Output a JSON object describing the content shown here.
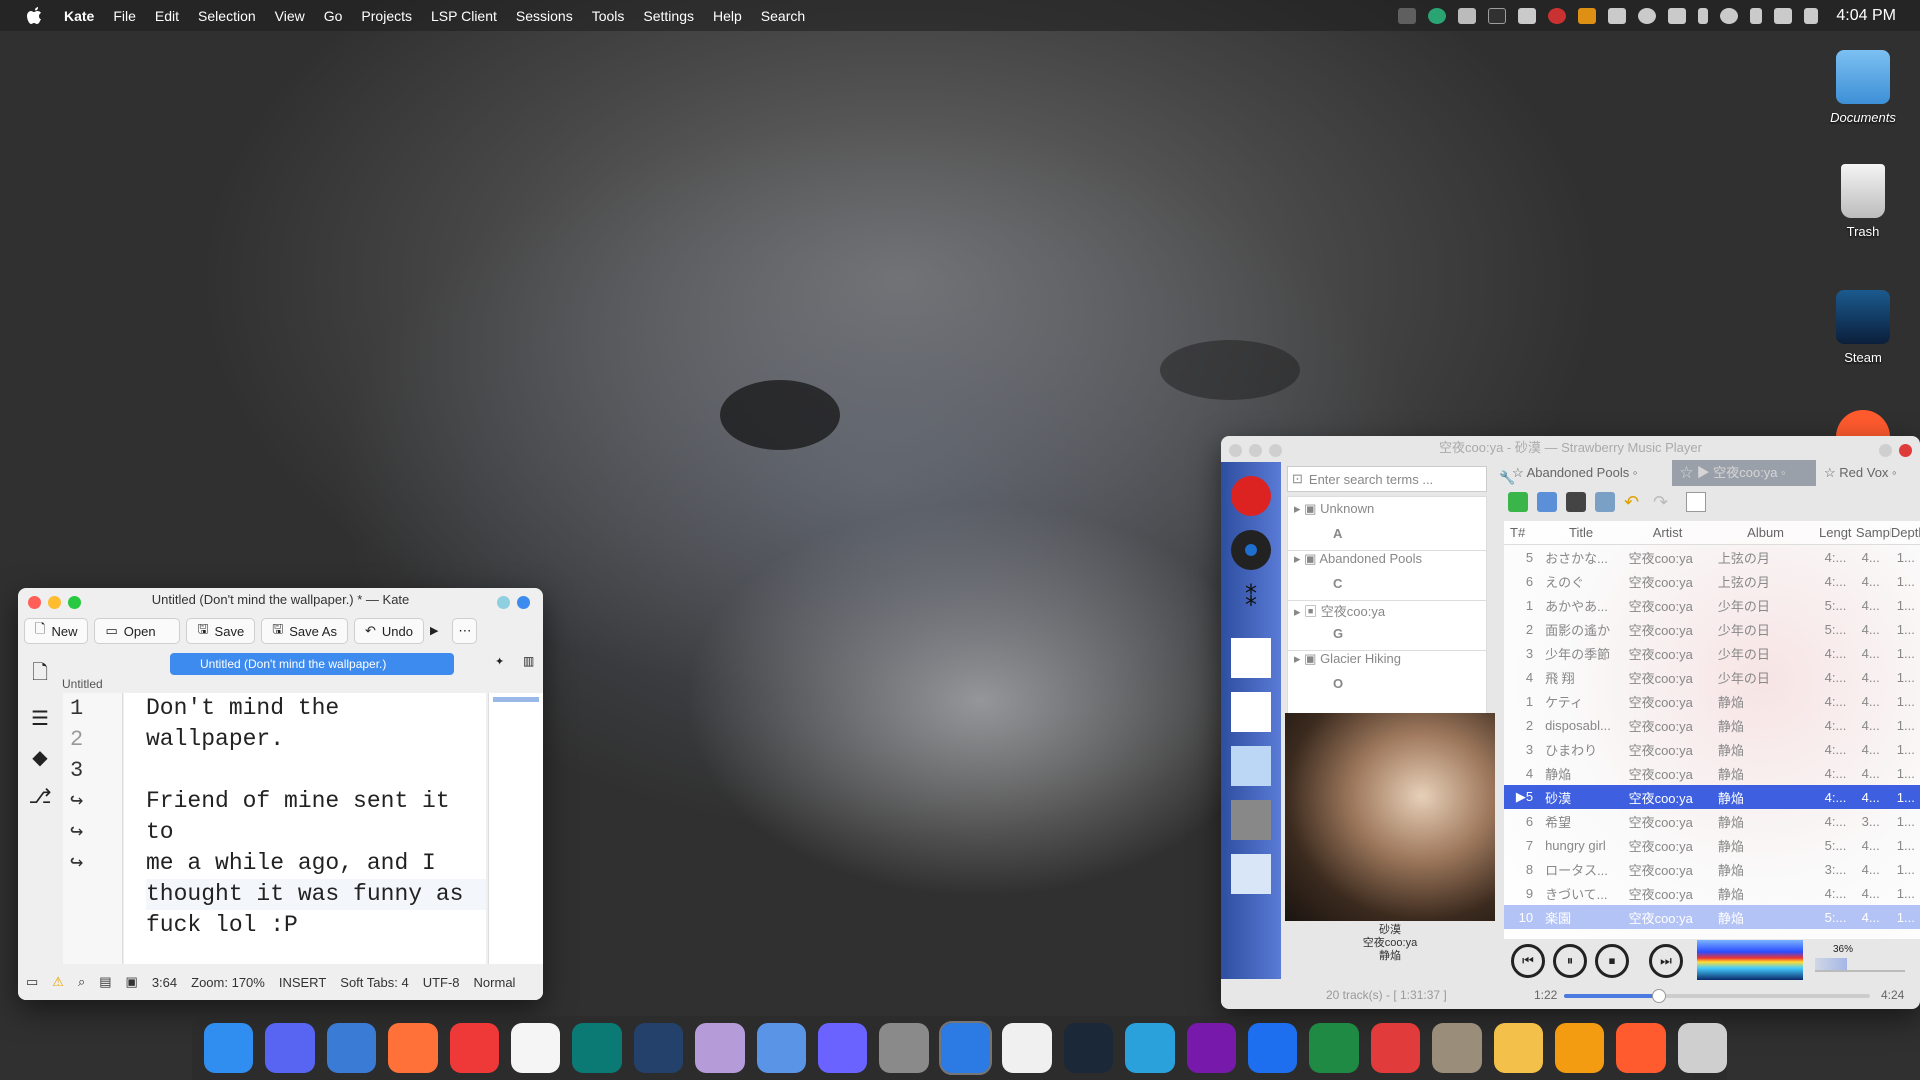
{
  "menubar": {
    "app": "Kate",
    "items": [
      "File",
      "Edit",
      "Selection",
      "View",
      "Go",
      "Projects",
      "LSP Client",
      "Sessions",
      "Tools",
      "Settings",
      "Help",
      "Search"
    ],
    "time": "4:04 PM"
  },
  "desktop": [
    {
      "label": "Documents"
    },
    {
      "label": "Trash"
    },
    {
      "label": "Steam"
    }
  ],
  "kate": {
    "title": "Untitled (Don't mind the wallpaper.) * — Kate",
    "toolbar": {
      "new": "New",
      "open": "Open",
      "save": "Save",
      "save_as": "Save As",
      "undo": "Undo"
    },
    "tab": "Untitled (Don't mind the wallpaper.)",
    "doc_label": "Untitled",
    "line_numbers": [
      "1",
      "2",
      "3",
      "↪",
      "↪",
      "↪"
    ],
    "lines": [
      "Don't mind the wallpaper.",
      "",
      "Friend of mine sent it to",
      "me a while ago, and I",
      "thought it was funny as",
      "fuck lol :P"
    ],
    "status": {
      "position": "3:64",
      "zoom": "Zoom: 170%",
      "mode": "INSERT",
      "tabs": "Soft Tabs: 4",
      "encoding": "UTF-8",
      "filetype": "Normal"
    }
  },
  "strawberry": {
    "title": "空夜coo:ya - 砂漠 — Strawberry Music Player",
    "search_placeholder": "Enter search terms ...",
    "collection": [
      {
        "name": "Unknown",
        "letter": "A"
      },
      {
        "name": "Abandoned Pools",
        "letter": "C"
      },
      {
        "name": "空夜coo:ya",
        "letter": "G"
      },
      {
        "name": "Glacier Hiking",
        "letter": "O"
      }
    ],
    "playlist_tabs": [
      "Abandoned Pools",
      "空夜coo:ya",
      "Red Vox"
    ],
    "columns": [
      "T#",
      "Title",
      "Artist",
      "Album",
      "Lengt",
      "Sample R",
      "Depth"
    ],
    "rows": [
      {
        "n": "5",
        "title": "おさかな...",
        "artist": "空夜coo:ya",
        "album": "上弦の月",
        "len": "4:...",
        "sr": "4...",
        "d": "1..."
      },
      {
        "n": "6",
        "title": "えのぐ",
        "artist": "空夜coo:ya",
        "album": "上弦の月",
        "len": "4:...",
        "sr": "4...",
        "d": "1..."
      },
      {
        "n": "1",
        "title": "あかやあ...",
        "artist": "空夜coo:ya",
        "album": "少年の日",
        "len": "5:...",
        "sr": "4...",
        "d": "1..."
      },
      {
        "n": "2",
        "title": "面影の遙か",
        "artist": "空夜coo:ya",
        "album": "少年の日",
        "len": "5:...",
        "sr": "4...",
        "d": "1..."
      },
      {
        "n": "3",
        "title": "少年の季節",
        "artist": "空夜coo:ya",
        "album": "少年の日",
        "len": "4:...",
        "sr": "4...",
        "d": "1..."
      },
      {
        "n": "4",
        "title": "飛 翔",
        "artist": "空夜coo:ya",
        "album": "少年の日",
        "len": "4:...",
        "sr": "4...",
        "d": "1..."
      },
      {
        "n": "1",
        "title": "ケティ",
        "artist": "空夜coo:ya",
        "album": "静焔",
        "len": "4:...",
        "sr": "4...",
        "d": "1..."
      },
      {
        "n": "2",
        "title": "disposabl...",
        "artist": "空夜coo:ya",
        "album": "静焔",
        "len": "4:...",
        "sr": "4...",
        "d": "1..."
      },
      {
        "n": "3",
        "title": "ひまわり",
        "artist": "空夜coo:ya",
        "album": "静焔",
        "len": "4:...",
        "sr": "4...",
        "d": "1..."
      },
      {
        "n": "4",
        "title": "静焔",
        "artist": "空夜coo:ya",
        "album": "静焔",
        "len": "4:...",
        "sr": "4...",
        "d": "1..."
      },
      {
        "n": "▶5",
        "title": "砂漠",
        "artist": "空夜coo:ya",
        "album": "静焔",
        "len": "4:...",
        "sr": "4...",
        "d": "1..."
      },
      {
        "n": "6",
        "title": "希望",
        "artist": "空夜coo:ya",
        "album": "静焔",
        "len": "4:...",
        "sr": "3...",
        "d": "1..."
      },
      {
        "n": "7",
        "title": "hungry girl",
        "artist": "空夜coo:ya",
        "album": "静焔",
        "len": "5:...",
        "sr": "4...",
        "d": "1..."
      },
      {
        "n": "8",
        "title": "ロータス...",
        "artist": "空夜coo:ya",
        "album": "静焔",
        "len": "3:...",
        "sr": "4...",
        "d": "1..."
      },
      {
        "n": "9",
        "title": "きづいて...",
        "artist": "空夜coo:ya",
        "album": "静焔",
        "len": "4:...",
        "sr": "4...",
        "d": "1..."
      },
      {
        "n": "10",
        "title": "楽園",
        "artist": "空夜coo:ya",
        "album": "静焔",
        "len": "5:...",
        "sr": "4...",
        "d": "1..."
      }
    ],
    "now_playing": {
      "title": "砂漠",
      "artist": "空夜coo:ya",
      "album": "静焔"
    },
    "volume": "36%",
    "volume_level": 0.36,
    "summary": "20 track(s) - [ 1:31:37 ]",
    "elapsed": "1:22",
    "total": "4:24",
    "progress": 0.31
  },
  "dock": [
    "finder",
    "discord",
    "qbittorrent",
    "firefox",
    "vivaldi",
    "notes",
    "gitkraken",
    "visual-studio",
    "preview",
    "gpu-tool",
    "infuse",
    "system-preferences",
    "swift",
    "todo",
    "steam",
    "telegram",
    "onenote",
    "word",
    "excel",
    "strawberry",
    "gimp",
    "photos",
    "pages",
    "tor",
    "trash"
  ]
}
